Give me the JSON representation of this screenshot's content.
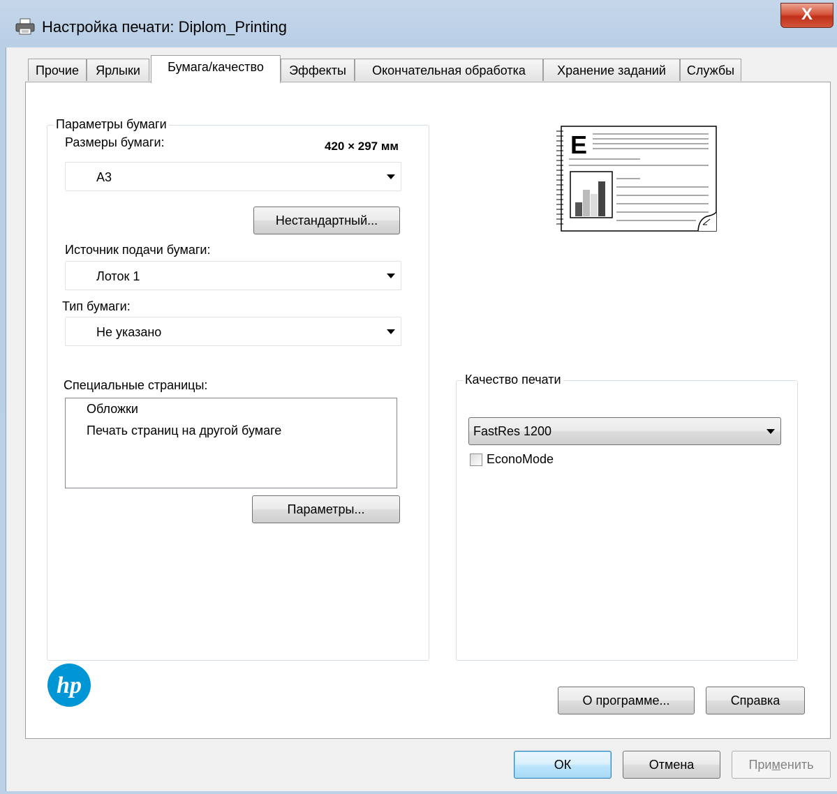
{
  "window": {
    "title": "Настройка печати: Diplom_Printing",
    "close_symbol": "X",
    "app_icon": "printer-icon"
  },
  "tabs": [
    {
      "label": "Прочие",
      "active": false
    },
    {
      "label": "Ярлыки",
      "active": false
    },
    {
      "label": "Бумага/качество",
      "active": true
    },
    {
      "label": "Эффекты",
      "active": false
    },
    {
      "label": "Окончательная обработка",
      "active": false
    },
    {
      "label": "Хранение заданий",
      "active": false
    },
    {
      "label": "Службы",
      "active": false
    }
  ],
  "paper": {
    "group_label": "Параметры бумаги",
    "size_label": "Размеры бумаги:",
    "size_dimensions": "420 × 297 мм",
    "size_value": "A3",
    "custom_button": "Нестандартный...",
    "source_label": "Источник подачи бумаги:",
    "source_value": "Лоток 1",
    "type_label": "Тип бумаги:",
    "type_value": "Не указано",
    "special_label": "Специальные страницы:",
    "special_items": [
      "Обложки",
      "Печать страниц на другой бумаге"
    ],
    "params_button": "Параметры..."
  },
  "preview": {
    "letter": "E",
    "icon": "page-preview-icon"
  },
  "quality": {
    "group_label": "Качество печати",
    "value": "FastRes 1200",
    "econo_label": "EconoMode",
    "econo_checked": false
  },
  "logo": {
    "text": "hp",
    "color": "#0096d6"
  },
  "panel_buttons": {
    "about": "О программе...",
    "help": "Справка"
  },
  "dialog_buttons": {
    "ok": "ОК",
    "cancel": "Отмена",
    "apply_pre": "При",
    "apply_mnemonic": "м",
    "apply_post": "енить"
  },
  "colors": {
    "close_button": "#c1301a",
    "hp_blue": "#0096d6",
    "default_button_border": "#3c7fb1"
  }
}
